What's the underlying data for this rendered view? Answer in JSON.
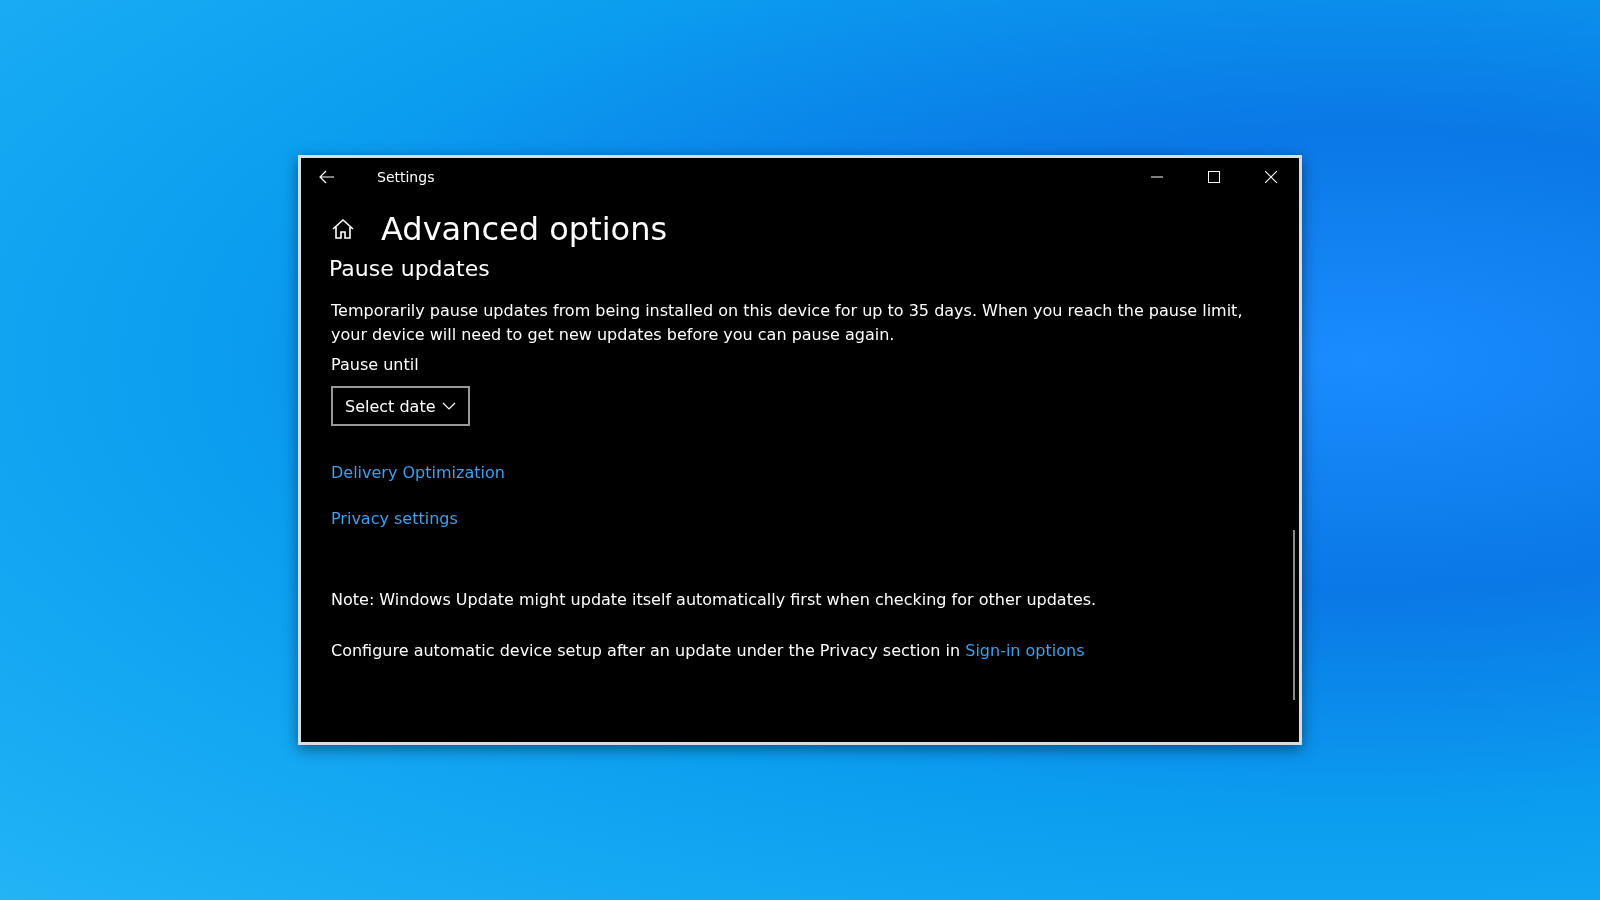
{
  "window": {
    "title": "Settings"
  },
  "page": {
    "title": "Advanced options"
  },
  "section": {
    "heading": "Pause updates",
    "description": "Temporarily pause updates from being installed on this device for up to 35 days. When you reach the pause limit, your device will need to get new updates before you can pause again.",
    "field_label": "Pause until",
    "dropdown": {
      "value": "Select date"
    }
  },
  "links": [
    "Delivery Optimization",
    "Privacy settings"
  ],
  "notes": [
    {
      "text": "Note: Windows Update might update itself automatically first when checking for other updates."
    },
    {
      "text": "Configure automatic device setup after an update under the Privacy section in ",
      "link": "Sign-in options"
    }
  ]
}
